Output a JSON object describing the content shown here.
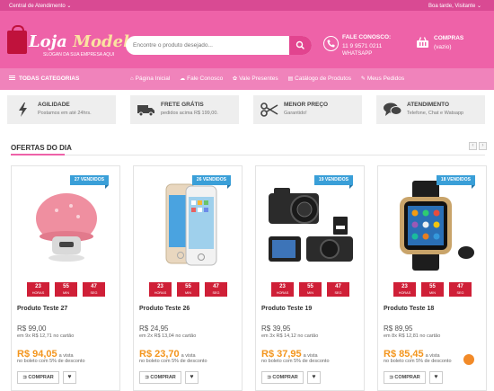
{
  "topbar": {
    "service_center": "Central de Atendimento ⌄",
    "greeting": "Boa tarde, Visitante ⌄"
  },
  "logo": {
    "name_part1": "Loja ",
    "name_part2": "Modelo",
    "slogan": "SLOGAN DA SUA EMPRESA AQUI"
  },
  "search": {
    "placeholder": "Encontre o produto desejado..."
  },
  "contact": {
    "title": "FALE CONOSCO:",
    "phone": "11 9 9571 0211",
    "channel": "WHATSAPP"
  },
  "cart": {
    "title": "COMPRAS",
    "status": "(vazio)"
  },
  "nav": {
    "all_categories": "TODAS CATEGORIAS",
    "links": [
      {
        "icon": "home-icon",
        "label": "Página Inicial"
      },
      {
        "icon": "chat-icon",
        "label": "Fale Conosco"
      },
      {
        "icon": "gift-icon",
        "label": "Vale Presentes"
      },
      {
        "icon": "catalog-icon",
        "label": "Catálogo de Produtos"
      },
      {
        "icon": "pencil-icon",
        "label": "Meus Pedidos"
      }
    ]
  },
  "features": [
    {
      "title": "AGILIDADE",
      "subtitle": "Postamos em até 24hrs.",
      "icon": "lightning-icon"
    },
    {
      "title": "FRETE GRÁTIS",
      "subtitle": "pedidos acima R$ 199,00.",
      "icon": "truck-icon"
    },
    {
      "title": "MENOR PREÇO",
      "subtitle": "Garantido!",
      "icon": "scissors-icon"
    },
    {
      "title": "ATENDIMENTO",
      "subtitle": "Telefone, Chat e Watsapp",
      "icon": "chat-bubble-icon"
    }
  ],
  "section": {
    "title": "OFERTAS DO DIA"
  },
  "timer_units": {
    "h": "HORAS",
    "m": "MIN",
    "s": "SEG"
  },
  "products": [
    {
      "badge": "27 VENDIDOS",
      "image": "bluetooth-speaker",
      "timer": {
        "h": "23",
        "m": "55",
        "s": "47"
      },
      "name": "Produto Teste 27",
      "price": "R$ 99,00",
      "installments": "em 9x R$ 12,71 no cartão",
      "sale_price": "R$ 94,05",
      "sale_note": "a vista",
      "boleto": "no boleto com 5% de desconto",
      "buy": "COMPRAR"
    },
    {
      "badge": "26 VENDIDOS",
      "image": "smartphone",
      "timer": {
        "h": "23",
        "m": "55",
        "s": "47"
      },
      "name": "Produto Teste 26",
      "price": "R$ 24,95",
      "installments": "em 2x R$ 13,04 no cartão",
      "sale_price": "R$ 23,70",
      "sale_note": "a vista",
      "boleto": "no boleto com 5% de desconto",
      "buy": "COMPRAR"
    },
    {
      "badge": "19 VENDIDOS",
      "image": "camera",
      "timer": {
        "h": "23",
        "m": "55",
        "s": "47"
      },
      "name": "Produto Teste 19",
      "price": "R$ 39,95",
      "installments": "em 3x R$ 14,12 no cartão",
      "sale_price": "R$ 37,95",
      "sale_note": "a vista",
      "boleto": "no boleto com 5% de desconto",
      "buy": "COMPRAR"
    },
    {
      "badge": "18 VENDIDOS",
      "image": "smartwatch",
      "timer": {
        "h": "23",
        "m": "55",
        "s": "47"
      },
      "name": "Produto Teste 18",
      "price": "R$ 89,95",
      "installments": "em 8x R$ 12,81 no cartão",
      "sale_price": "R$ 85,45",
      "sale_note": "a vista",
      "boleto": "no boleto com 5% de desconto",
      "buy": "COMPRAR"
    }
  ],
  "colors": {
    "primary": "#ee62a8",
    "nav": "#f083bb",
    "timer": "#cf1f37",
    "badge": "#3a9fd8",
    "sale": "#f3951d"
  }
}
